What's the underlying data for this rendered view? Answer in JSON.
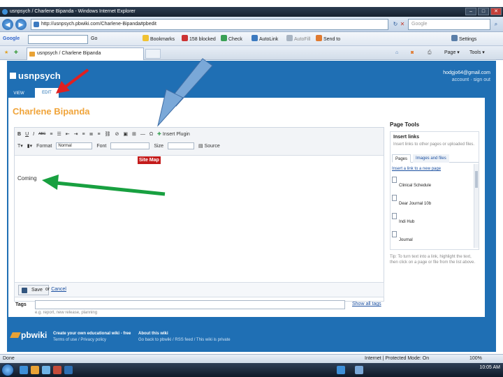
{
  "window": {
    "title": "usnpsych / Charlene Bipanda - Windows Internet Explorer",
    "address": "http://usnpsych.pbwiki.com/Charlene-Bipanda#pbedit",
    "search_placeholder": "Google"
  },
  "toolbar": {
    "google_label": "Google",
    "go_label": "Go",
    "bookmarks_label": "Bookmarks",
    "blocked_label": "158 blocked",
    "check_label": "Check",
    "autolink_label": "AutoLink",
    "autofill_label": "AutoFill",
    "sendto_label": "Send to",
    "settings_label": "Settings"
  },
  "tabs": {
    "page_tab_label": "usnpsych / Charlene Bipanda",
    "page_menu": "Page",
    "tools_menu": "Tools"
  },
  "site": {
    "brand": "usnpsych",
    "user_email": "hodgjo64@gmail.com",
    "account_links": "account · sign out",
    "view_tab": "VIEW",
    "edit_tab": "EDIT",
    "page_title": "Charlene Bipanda"
  },
  "editor": {
    "bold": "B",
    "italic": "I",
    "underline": "U",
    "strike": "ABC",
    "insert_plugin": "Insert Plugin",
    "format_label": "Format",
    "format_value": "Normal",
    "font_label": "Font",
    "size_label": "Size",
    "source_label": "Source",
    "sitemap_text": "Site Map",
    "body_text": "Coming",
    "save_label": "Save",
    "or_text": "or",
    "cancel_label": "Cancel",
    "tags_label": "Tags",
    "tags_hint": "e.g. report, new release, planning",
    "show_all_tags": "Show all tags"
  },
  "page_tools": {
    "title": "Page Tools",
    "insert_links_heading": "Insert links",
    "insert_links_desc": "Insert links to other pages or uploaded files.",
    "tab_pages": "Pages",
    "tab_images": "Images and files",
    "new_page_link": "Insert a link to a new page",
    "items": [
      {
        "name": "Clinical Schedule"
      },
      {
        "name": "Dear Journal 10b"
      },
      {
        "name": "Indi Hub"
      },
      {
        "name": "Journal"
      }
    ],
    "tip": "Tip: To turn text into a link, highlight the text, then click on a page or file from the list above."
  },
  "footer": {
    "logo": "pbwiki",
    "create_heading": "Create your own educational wiki - free",
    "create_links": "Terms of use / Privacy policy",
    "about_heading": "About this wiki",
    "about_links": "Go back to pbwiki / RSS feed / This wiki is private"
  },
  "status": {
    "left": "Done",
    "zone": "Internet | Protected Mode: On",
    "zoom": "100%"
  },
  "taskbar": {
    "time": "10:05 AM"
  },
  "annotations": {
    "arrow_colors": [
      "#e02020",
      "#7aa8d8",
      "#18a040"
    ]
  }
}
